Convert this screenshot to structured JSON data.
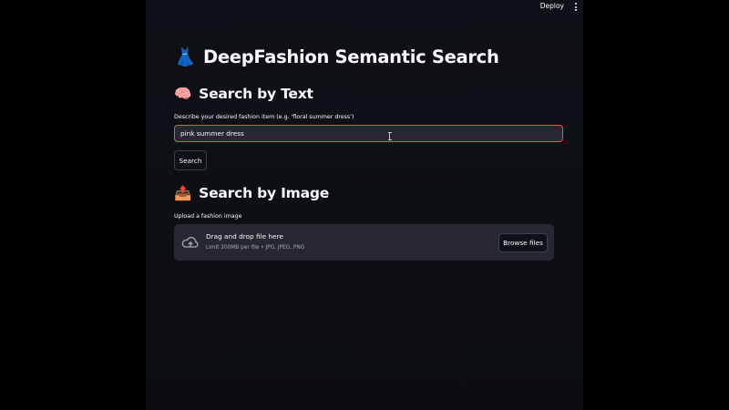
{
  "topbar": {
    "deploy_label": "Deploy",
    "menu_icon": "kebab-menu-icon"
  },
  "page": {
    "title_emoji": "👗",
    "title": "DeepFashion Semantic Search"
  },
  "text_search": {
    "header_emoji": "🧠",
    "header": "Search by Text",
    "input_label": "Describe your desired fashion item (e.g. 'floral summer dress')",
    "input_value": "pink summer dress",
    "search_button": "Search"
  },
  "image_search": {
    "header_emoji": "📤",
    "header": "Search by Image",
    "upload_label": "Upload a fashion image",
    "dropzone_title": "Drag and drop file here",
    "dropzone_subtitle": "Limit 200MB per file • JPG, JPEG, PNG",
    "browse_button": "Browse files",
    "upload_icon": "cloud-upload-icon"
  },
  "colors": {
    "app_background": "#0e1117",
    "outer_background": "#000000",
    "input_background": "#262730",
    "focus_border": "#ff4b4b",
    "text": "#fafafa",
    "muted_text": "#a3a8b8"
  }
}
